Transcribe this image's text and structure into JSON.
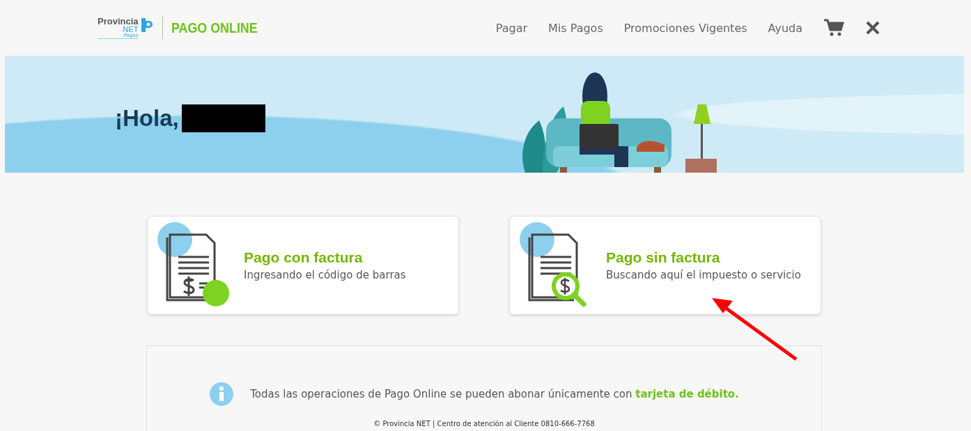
{
  "header": {
    "logo": {
      "brand": "Provincia",
      "sub": "NET",
      "tag": "Pagos",
      "product": "PAGO ONLINE"
    },
    "nav": [
      {
        "label": "Pagar"
      },
      {
        "label": "Mis Pagos"
      },
      {
        "label": "Promociones Vigentes"
      },
      {
        "label": "Ayuda"
      }
    ]
  },
  "hero": {
    "greeting": "¡Hola,"
  },
  "cards": [
    {
      "kind": "invoice",
      "title": "Pago con factura",
      "subtitle": "Ingresando el código de barras"
    },
    {
      "kind": "search",
      "title": "Pago sin factura",
      "subtitle": "Buscando aquí el impuesto o servicio"
    }
  ],
  "notice": {
    "text": "Todas las operaciones de Pago Online se pueden abonar únicamente con **tarjeta de débito.**"
  },
  "footer": {
    "text": "© Provincia NET | Centro de atención al Cliente 0810-666-7768"
  }
}
